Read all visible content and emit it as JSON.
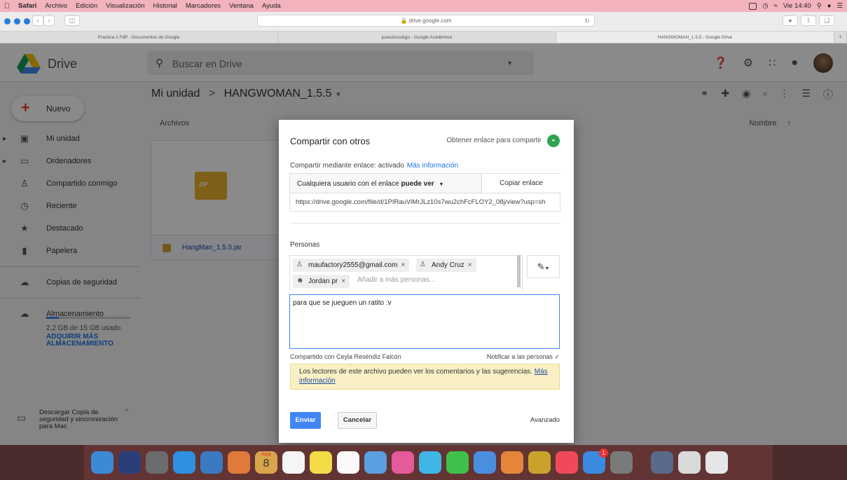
{
  "menubar": {
    "items": [
      "Safari",
      "Archivo",
      "Edición",
      "Visualización",
      "Historial",
      "Marcadores",
      "Ventana",
      "Ayuda"
    ],
    "clock": "Vie 14:40"
  },
  "browser": {
    "url": "drive.google.com",
    "tabs": [
      {
        "label": "Practica 1 FdP - Documentos de Google"
      },
      {
        "label": "pseudocodigo - Google Académico"
      },
      {
        "label": "HANGWOMAN_1.5.5 - Google Drive"
      }
    ],
    "new_tab": "+"
  },
  "drive": {
    "logo_text": "Drive",
    "search_placeholder": "Buscar en Drive",
    "new_label": "Nuevo",
    "breadcrumb": {
      "root": "Mi unidad",
      "separator": ">",
      "current": "HANGWOMAN_1.5.5"
    },
    "nav": [
      {
        "label": "Mi unidad",
        "icon": "drive-icon"
      },
      {
        "label": "Ordenadores",
        "icon": "computer-icon"
      },
      {
        "label": "Compartido conmigo",
        "icon": "people-icon"
      },
      {
        "label": "Reciente",
        "icon": "clock-icon"
      },
      {
        "label": "Destacado",
        "icon": "star-icon"
      },
      {
        "label": "Papelera",
        "icon": "trash-icon"
      },
      {
        "label": "Copias de seguridad",
        "icon": "cloud-icon"
      },
      {
        "label": "Almacenamiento",
        "icon": "cloud-outline-icon"
      }
    ],
    "storage": {
      "used_text": "2,2 GB de 15 GB usado",
      "used_fraction": 0.147,
      "upgrade": "ADQUIRIR MÁS ALMACENAMIENTO"
    },
    "files_label": "Archivos",
    "sort_label": "Nombre",
    "file": {
      "name": "HangMan_1.5.5.jar",
      "thumb_text": "ZIP"
    },
    "download_box": {
      "text": "Descargar Copia de seguridad y sincronización para Mac",
      "close": "×"
    }
  },
  "dialog": {
    "title": "Compartir con otros",
    "get_link": "Obtener enlace para compartir",
    "link_status": "Compartir mediante enlace: activado",
    "more_info": "Más información",
    "permission_prefix": "Cualquiera usuario con el enlace",
    "permission_bold": "puede ver",
    "copy_link": "Copiar enlace",
    "url": "https://drive.google.com/file/d/1PIRauViMrJLz10s7wu2chFcFLOY2_08j/view?usp=sh",
    "people_label": "Personas",
    "chips": [
      {
        "label": "maufactory2555@gmail.com"
      },
      {
        "label": "Andy Cruz"
      },
      {
        "label": "Jordan pr"
      }
    ],
    "chip_remove": "×",
    "add_placeholder": "Añadir a más personas...",
    "message": "para que se jueguen un ratito :v",
    "shared_with": "Compartido con Ceyla Reséndiz Falcón",
    "notify": "Notificar a las personas",
    "notice_text": "Los lectores de este archivo pueden ver los comentarios y las sugerencias.",
    "notice_link": "Más información",
    "send": "Enviar",
    "cancel": "Cancelar",
    "advanced": "Avanzado"
  },
  "dock": {
    "calendar_month": "FEB",
    "calendar_day": "8",
    "appstore_badge": "1",
    "app_colors": [
      "#3c8ad6",
      "#2a3e7a",
      "#6c6c6c",
      "#2f8fe0",
      "#3a7ac2",
      "#e07a3a",
      "#d9a54c",
      "#f5f5f5",
      "#f3dc48",
      "#fafafa",
      "#5aa0e0",
      "#e45a9a",
      "#3fb6e6",
      "#3ec14a",
      "#4a8ee0",
      "#e5853a",
      "#c9a22b",
      "#f04a5a",
      "#3c8ae0",
      "#7a7a7a",
      "#5a6a8a",
      "#d9d9d9",
      "#e6e6e6"
    ]
  }
}
